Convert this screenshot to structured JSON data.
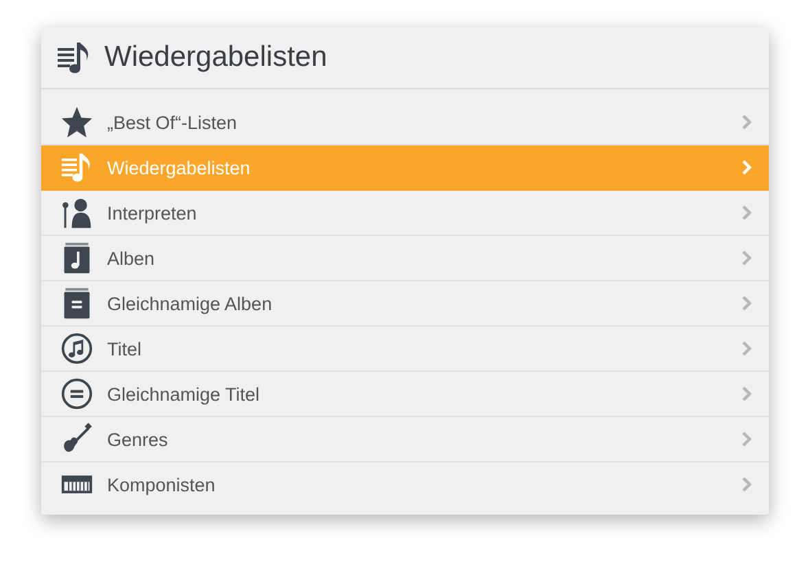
{
  "header": {
    "title": "Wiedergabelisten"
  },
  "items": [
    {
      "label": "„Best Of“-Listen",
      "selected": false
    },
    {
      "label": "Wiedergabelisten",
      "selected": true
    },
    {
      "label": "Interpreten",
      "selected": false
    },
    {
      "label": "Alben",
      "selected": false
    },
    {
      "label": "Gleichnamige Alben",
      "selected": false
    },
    {
      "label": "Titel",
      "selected": false
    },
    {
      "label": "Gleichnamige Titel",
      "selected": false
    },
    {
      "label": "Genres",
      "selected": false
    },
    {
      "label": "Komponisten",
      "selected": false
    }
  ]
}
